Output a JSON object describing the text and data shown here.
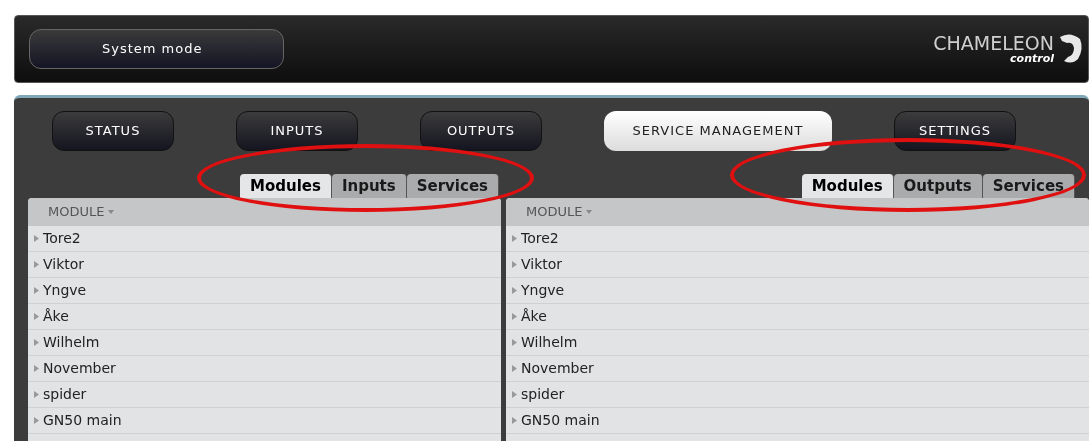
{
  "header": {
    "mode_button": "System mode",
    "logo": {
      "name": "CHAMELEON",
      "sub": "control"
    }
  },
  "nav": [
    {
      "label": "STATUS",
      "selected": false
    },
    {
      "label": "INPUTS",
      "selected": false
    },
    {
      "label": "OUTPUTS",
      "selected": false
    },
    {
      "label": "SERVICE MANAGEMENT",
      "selected": true
    },
    {
      "label": "SETTINGS",
      "selected": false
    }
  ],
  "panels": [
    {
      "tabs": [
        {
          "label": "Modules",
          "selected": true
        },
        {
          "label": "Inputs",
          "selected": false
        },
        {
          "label": "Services",
          "selected": false
        }
      ],
      "column": "MODULE",
      "rows": [
        "Tore2",
        "Viktor",
        "Yngve",
        "Åke",
        "Wilhelm",
        "November",
        "spider",
        "GN50 main"
      ]
    },
    {
      "tabs": [
        {
          "label": "Modules",
          "selected": true
        },
        {
          "label": "Outputs",
          "selected": false
        },
        {
          "label": "Services",
          "selected": false
        }
      ],
      "column": "MODULE",
      "rows": [
        "Tore2",
        "Viktor",
        "Yngve",
        "Åke",
        "Wilhelm",
        "November",
        "spider",
        "GN50 main"
      ]
    }
  ]
}
